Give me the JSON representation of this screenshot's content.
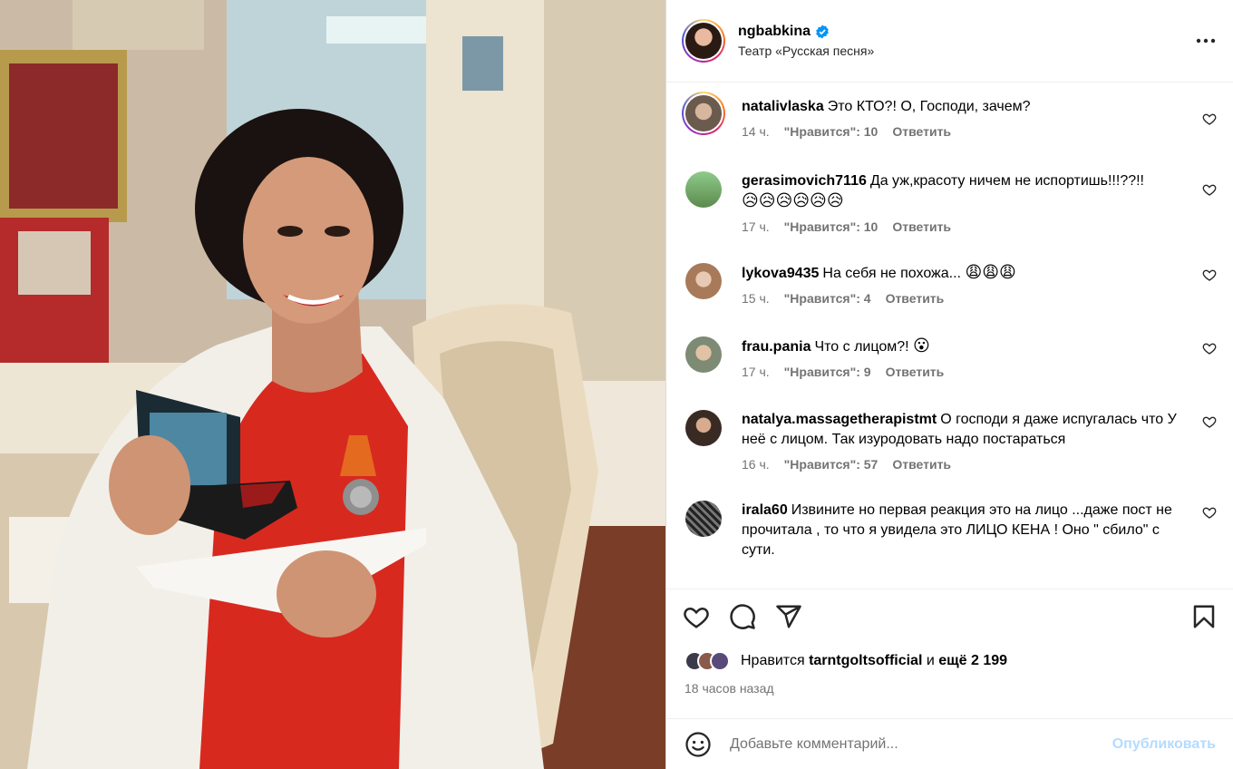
{
  "post": {
    "username": "ngbabkina",
    "location": "Театр «Русская песня»",
    "verified": true,
    "accent_color": "#0095f6"
  },
  "comments": [
    {
      "username": "natalivlaska",
      "text": "Это КТО?! О, Господи, зачем?",
      "emoji": "",
      "time": "14 ч.",
      "likes": "\"Нравится\": 10",
      "reply": "Ответить",
      "has_story_ring": true
    },
    {
      "username": "gerasimovich7116",
      "text": "Да уж,красоту ничем не испортишь!!!??!!",
      "emoji": "😥😥😥😥😥😥",
      "time": "17 ч.",
      "likes": "\"Нравится\": 10",
      "reply": "Ответить",
      "has_story_ring": false
    },
    {
      "username": "lykova9435",
      "text": "На себя не похожа...",
      "emoji": "😩😩😩",
      "time": "15 ч.",
      "likes": "\"Нравится\": 4",
      "reply": "Ответить",
      "has_story_ring": false
    },
    {
      "username": "frau.pania",
      "text": "Что с лицом?!",
      "emoji": "😮",
      "time": "17 ч.",
      "likes": "\"Нравится\": 9",
      "reply": "Ответить",
      "has_story_ring": false
    },
    {
      "username": "natalya.massagetherapistmt",
      "text": "О господи я даже испугалась что У неё с лицом. Так изуродовать надо постараться",
      "emoji": "",
      "time": "16 ч.",
      "likes": "\"Нравится\": 57",
      "reply": "Ответить",
      "has_story_ring": false
    },
    {
      "username": "irala60",
      "text": "Извините но первая реакция это на лицо ...даже пост не прочитала , то что я увидела это ЛИЦО КЕНА ! Оно \" сбило\" с сути.",
      "emoji": "",
      "time": "",
      "likes": "",
      "reply": "",
      "has_story_ring": false
    }
  ],
  "actions": {
    "like_icon": "heart-icon",
    "comment_icon": "comment-icon",
    "share_icon": "share-icon",
    "save_icon": "bookmark-icon"
  },
  "likes": {
    "prefix": "Нравится",
    "user": "tarntgoltsofficial",
    "middle": "и",
    "others": "ещё 2 199"
  },
  "time_ago": "18 часов назад",
  "add_comment": {
    "placeholder": "Добавьте комментарий...",
    "publish_label": "Опубликовать"
  }
}
